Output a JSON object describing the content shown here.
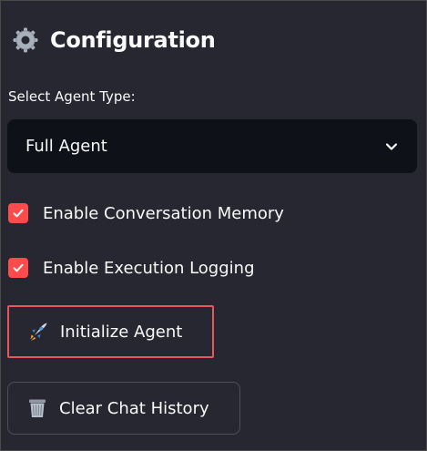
{
  "header": {
    "title": "Configuration",
    "icon": "gear-icon"
  },
  "agent_select": {
    "label": "Select Agent Type:",
    "value": "Full Agent",
    "icon": "chevron-down-icon"
  },
  "options": [
    {
      "label": "Enable Conversation Memory",
      "checked": true
    },
    {
      "label": "Enable Execution Logging",
      "checked": true
    }
  ],
  "buttons": {
    "initialize": {
      "label": "Initialize Agent",
      "icon": "rocket-icon"
    },
    "clear": {
      "label": "Clear Chat History",
      "icon": "wastebasket-icon"
    }
  },
  "colors": {
    "background": "#262730",
    "select_background": "#0e1117",
    "checkbox": "#ff4b4b",
    "focus_border": "#e8565b"
  }
}
